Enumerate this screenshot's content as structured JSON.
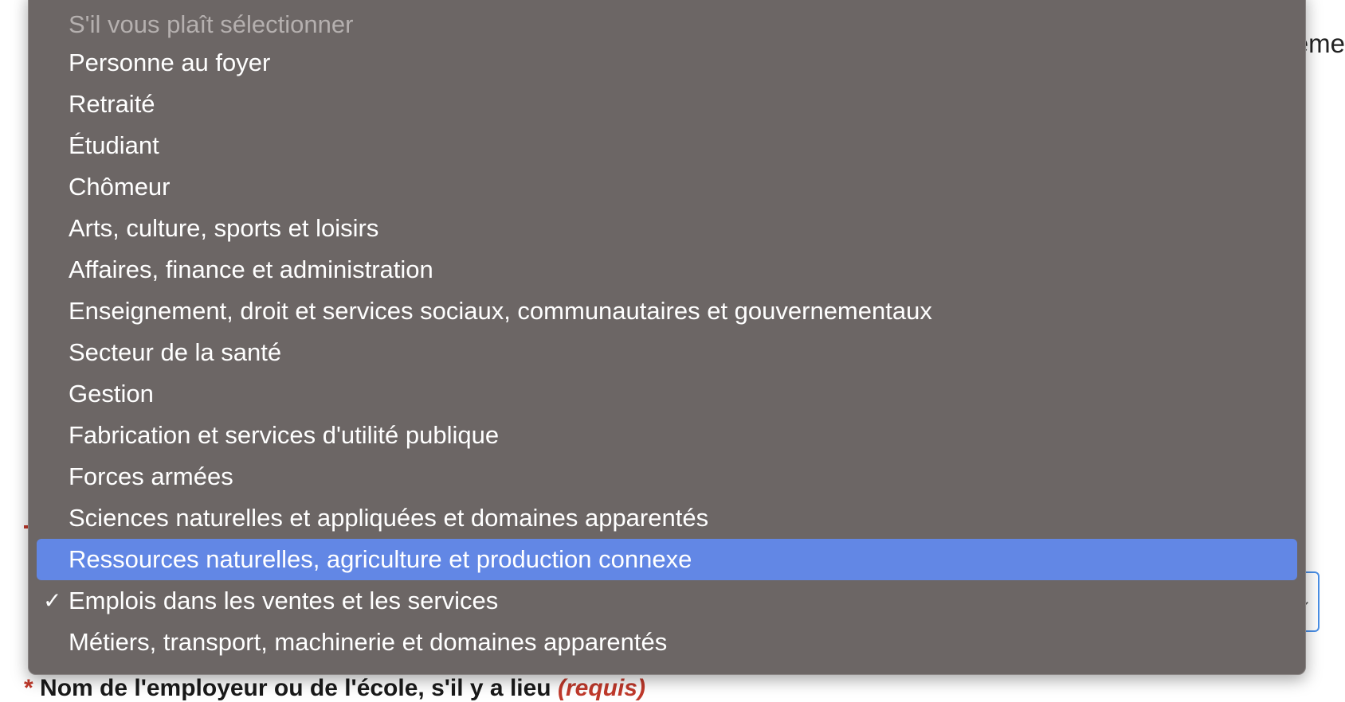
{
  "background": {
    "right_text": "eme",
    "field_label_prefix": "*",
    "field_label": "Nom de l'employeur ou de l'école, s'il y a lieu",
    "field_label_required": "(requis)"
  },
  "dropdown": {
    "placeholder": "S'il vous plaît sélectionner",
    "options": [
      "Personne au foyer",
      "Retraité",
      "Étudiant",
      "Chômeur",
      "Arts, culture, sports et loisirs",
      "Affaires, finance et administration",
      "Enseignement, droit et services sociaux, communautaires et gouvernementaux",
      "Secteur de la santé",
      "Gestion",
      "Fabrication et services d'utilité publique",
      "Forces armées",
      "Sciences naturelles et appliquées et domaines apparentés",
      "Ressources naturelles, agriculture et production connexe",
      "Emplois dans les ventes et les services",
      "Métiers, transport, machinerie et domaines apparentés"
    ],
    "highlighted_option": "Ressources naturelles, agriculture et production connexe",
    "selected_option": "Emplois dans les ventes et les services",
    "check_glyph": "✓",
    "highlight_color": "#6287e5"
  }
}
